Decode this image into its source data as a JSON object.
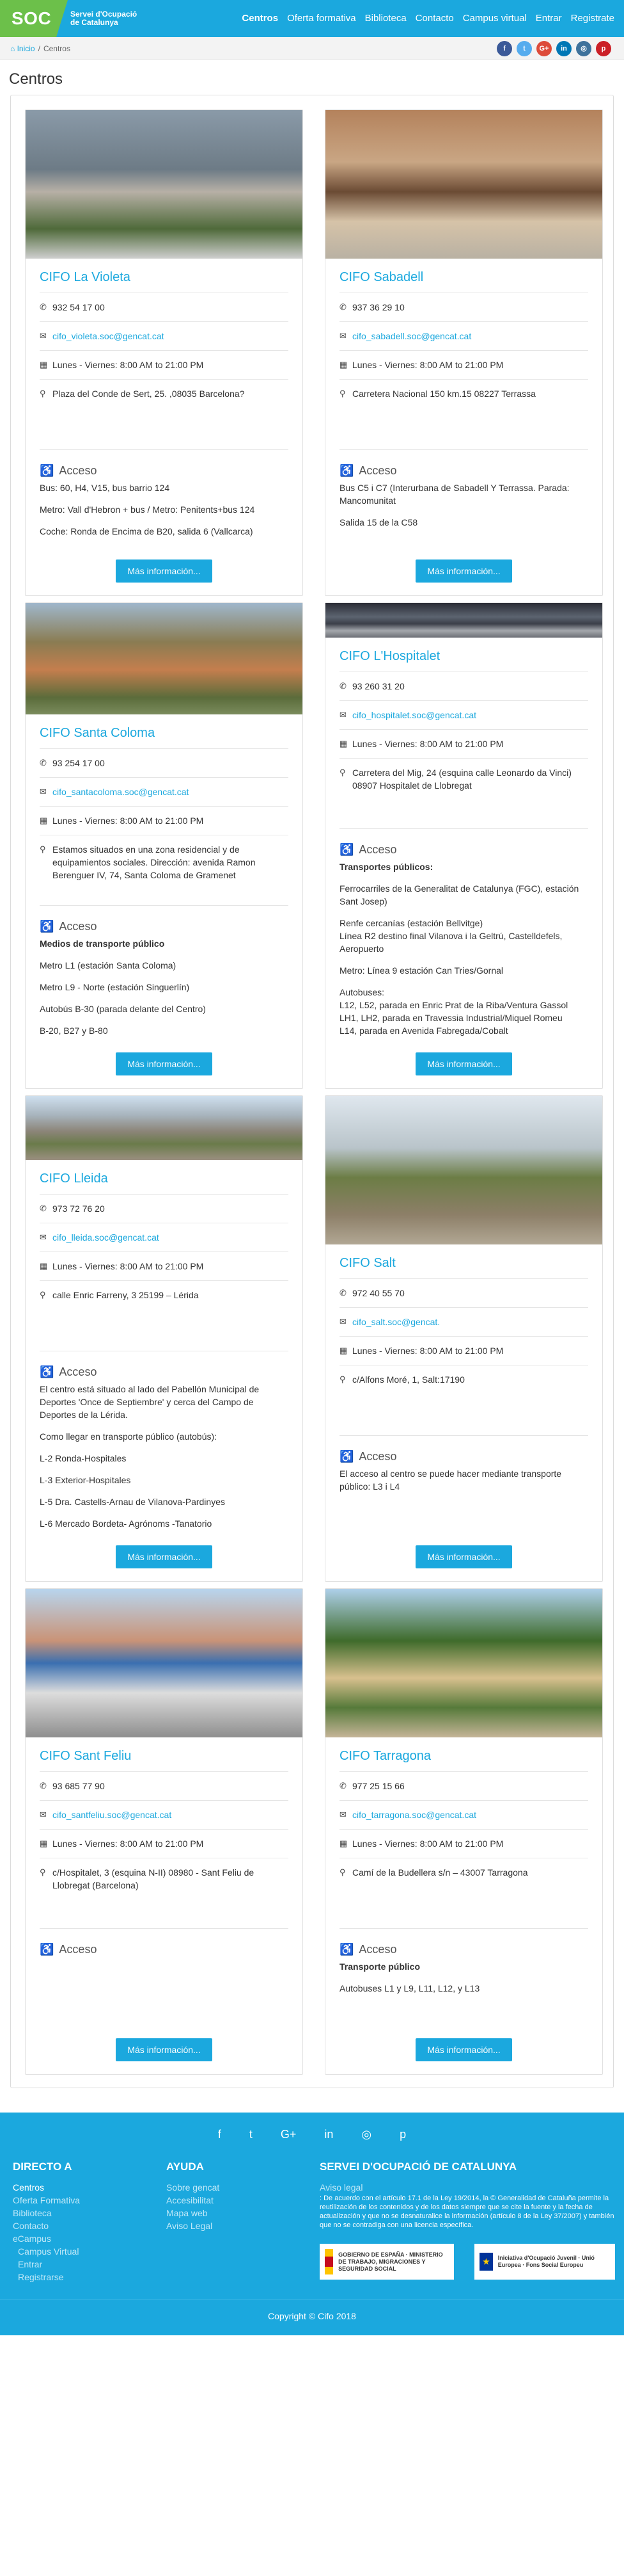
{
  "brand": {
    "logo": "SOC",
    "line1": "Servei d'Ocupació",
    "line2": "de Catalunya"
  },
  "nav": [
    "Centros",
    "Oferta formativa",
    "Biblioteca",
    "Contacto",
    "Campus virtual",
    "Entrar",
    "Registrate"
  ],
  "breadcrumb": {
    "home": "Inicio",
    "sep": "/",
    "current": "Centros"
  },
  "social_top": [
    {
      "icon": "facebook-icon",
      "glyph": "f",
      "color": "#3b5998"
    },
    {
      "icon": "twitter-icon",
      "glyph": "t",
      "color": "#55acee"
    },
    {
      "icon": "google-plus-icon",
      "glyph": "G+",
      "color": "#dd4b39"
    },
    {
      "icon": "linkedin-icon",
      "glyph": "in",
      "color": "#0077b5"
    },
    {
      "icon": "instagram-icon",
      "glyph": "◎",
      "color": "#3f729b"
    },
    {
      "icon": "pinterest-icon",
      "glyph": "p",
      "color": "#cb2027"
    }
  ],
  "page_title": "Centros",
  "centers": [
    {
      "name": "CIFO La Violeta",
      "phone": "932 54 17 00",
      "email": "cifo_violeta.soc@gencat.cat",
      "hours": "Lunes - Viernes: 8:00 AM to 21:00 PM",
      "address": "Plaza del Conde de Sert, 25. ,08035 Barcelona?",
      "acceso_title": "Acceso",
      "acceso_head": "",
      "acceso": [
        "Bus: 60, H4, V15, bus barrio 124",
        "Metro: Vall d'Hebron + bus / Metro: Penitents+bus 124",
        "Coche: Ronda de Encima de B20, salida 6 (Vallcarca)"
      ],
      "button": "Más información..."
    },
    {
      "name": "CIFO Sabadell",
      "phone": "937 36 29 10",
      "email": "cifo_sabadell.soc@gencat.cat",
      "hours": "Lunes - Viernes: 8:00 AM to 21:00 PM",
      "address": "Carretera Nacional 150 km.15 08227 Terrassa",
      "acceso_title": "Acceso",
      "acceso_head": "",
      "acceso": [
        "Bus C5 i C7 (Interurbana de Sabadell Y Terrassa. Parada: Mancomunitat",
        "Salida 15 de la C58"
      ],
      "button": "Más información..."
    },
    {
      "name": "CIFO Santa Coloma",
      "phone": "93 254 17 00",
      "email": "cifo_santacoloma.soc@gencat.cat",
      "hours": "Lunes - Viernes: 8:00 AM to 21:00 PM",
      "address": "Estamos situados en una zona residencial y de equipamientos sociales. Dirección: avenida Ramon Berenguer IV, 74, Santa Coloma de Gramenet",
      "acceso_title": "Acceso",
      "acceso_head": "Medios de transporte público",
      "acceso": [
        "Metro L1 (estación Santa Coloma)",
        "Metro L9 - Norte (estación Singuerlín)",
        "Autobús B-30 (parada delante del Centro)",
        "B-20, B27 y B-80"
      ],
      "button": "Más información..."
    },
    {
      "name": "CIFO L'Hospitalet",
      "phone": "93 260 31 20",
      "email": "cifo_hospitalet.soc@gencat.cat",
      "hours": "Lunes - Viernes: 8:00 AM to 21:00 PM",
      "address": "Carretera del Mig, 24 (esquina calle Leonardo da Vinci) 08907 Hospitalet de Llobregat",
      "acceso_title": "Acceso",
      "acceso_head": "Transportes públicos:",
      "acceso": [
        "Ferrocarriles de la Generalitat de Catalunya (FGC), estación Sant Josep)",
        "Renfe cercanías (estación Bellvitge)\nLínea R2 destino final Vilanova i la Geltrú, Castelldefels, Aeropuerto",
        "Metro: Línea 9 estación Can Tries/Gornal",
        "Autobuses:\nL12, L52, parada en Enric Prat de la Riba/Ventura Gassol\nLH1, LH2, parada en Travessia Industrial/Miquel Romeu\nL14, parada en Avenida Fabregada/Cobalt"
      ],
      "button": "Más información..."
    },
    {
      "name": "CIFO Lleida",
      "phone": "973 72 76 20",
      "email": "cifo_lleida.soc@gencat.cat",
      "hours": "Lunes - Viernes: 8:00 AM to 21:00 PM",
      "address": "calle Enric Farreny, 3 25199 – Lérida",
      "acceso_title": "Acceso",
      "acceso_head": "",
      "acceso": [
        "El centro está situado al lado del Pabellón Municipal de Deportes 'Once de Septiembre' y cerca del Campo de Deportes de la Lérida.",
        "Como llegar en transporte público (autobús):",
        "L-2 Ronda-Hospitales",
        "L-3 Exterior-Hospitales",
        "L-5 Dra. Castells-Arnau de Vilanova-Pardinyes",
        "L-6 Mercado Bordeta- Agrónoms -Tanatorio"
      ],
      "button": "Más información..."
    },
    {
      "name": "CIFO Salt",
      "phone": "972 40 55 70",
      "email": "cifo_salt.soc@gencat.",
      "hours": "Lunes - Viernes: 8:00 AM to 21:00 PM",
      "address": "c/Alfons Moré, 1, Salt:17190",
      "acceso_title": "Acceso",
      "acceso_head": "",
      "acceso": [
        "El acceso al centro se puede hacer mediante transporte público: L3 i L4"
      ],
      "button": "Más información..."
    },
    {
      "name": "CIFO Sant Feliu",
      "phone": "93 685 77 90",
      "email": "cifo_santfeliu.soc@gencat.cat",
      "hours": "Lunes - Viernes: 8:00 AM to 21:00 PM",
      "address": "c/Hospitalet, 3 (esquina N-II) 08980 - Sant Feliu de Llobregat (Barcelona)",
      "acceso_title": "Acceso",
      "acceso_head": "",
      "acceso": [],
      "button": "Más información..."
    },
    {
      "name": "CIFO Tarragona",
      "phone": "977 25 15 66",
      "email": "cifo_tarragona.soc@gencat.cat",
      "hours": "Lunes - Viernes: 8:00 AM to 21:00 PM",
      "address": "Camí de la Budellera s/n – 43007 Tarragona",
      "acceso_title": "Acceso",
      "acceso_head": "Transporte público",
      "acceso": [
        "Autobuses L1 y L9, L11, L12, y L13"
      ],
      "button": "Más información..."
    }
  ],
  "footer": {
    "social": [
      {
        "icon": "facebook-icon",
        "glyph": "f"
      },
      {
        "icon": "twitter-icon",
        "glyph": "t"
      },
      {
        "icon": "google-plus-icon",
        "glyph": "G+"
      },
      {
        "icon": "linkedin-icon",
        "glyph": "in"
      },
      {
        "icon": "instagram-icon",
        "glyph": "◎"
      },
      {
        "icon": "pinterest-icon",
        "glyph": "p"
      }
    ],
    "directo_title": "DIRECTO A",
    "directo": [
      {
        "label": "Centros",
        "strong": true,
        "sub": false
      },
      {
        "label": "Oferta Formativa",
        "strong": false,
        "sub": false
      },
      {
        "label": "Biblioteca",
        "strong": false,
        "sub": false
      },
      {
        "label": "Contacto",
        "strong": false,
        "sub": false
      },
      {
        "label": "eCampus",
        "strong": false,
        "sub": false
      },
      {
        "label": "Campus Virtual",
        "strong": false,
        "sub": true
      },
      {
        "label": "Entrar",
        "strong": false,
        "sub": true
      },
      {
        "label": "Registrarse",
        "strong": false,
        "sub": true
      }
    ],
    "ayuda_title": "AYUDA",
    "ayuda": [
      "Sobre gencat",
      "Accesibilitat",
      "Mapa web",
      "Aviso Legal"
    ],
    "soc_title": "SERVEI D'OCUPACIÓ DE CATALUNYA",
    "legal_label": "Aviso legal",
    "legal_text": ": De acuerdo con el artículo 17.1 de la Ley 19/2014, la © Generalidad de Cataluña permite la reutilización de los contenidos y de los datos siempre que se cite la fuente y la fecha de actualización y que no se desnaturalice la información (artículo 8 de la Ley 37/2007) y también que no se contradiga con una licencia específica.",
    "logo1": "GOBIERNO DE ESPAÑA · MINISTERIO DE TRABAJO, MIGRACIONES Y SEGURIDAD SOCIAL",
    "logo2": "Iniciativa d'Ocupació Juvenil · Unió Europea · Fons Social Europeu",
    "copyright": "Copyright © Cifo 2018"
  }
}
